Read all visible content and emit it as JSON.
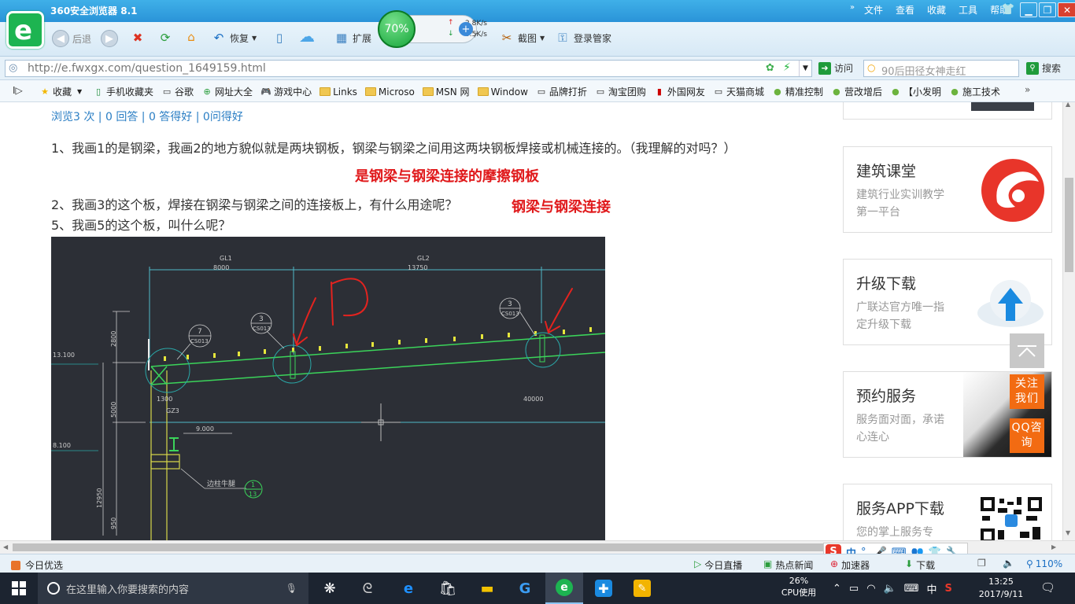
{
  "window": {
    "title": "360安全浏览器 8.1",
    "menu": [
      "文件",
      "查看",
      "收藏",
      "工具",
      "帮助"
    ]
  },
  "toolbar": {
    "back_label": "后退",
    "restore_label": "恢复",
    "extend_label": "扩展",
    "screenshot_label": "截图",
    "login_label": "登录管家"
  },
  "speed_widget": {
    "percent": "70%",
    "up": "2.8K/s",
    "down": "0.5K/s"
  },
  "address": {
    "url": "http://e.fwxgx.com/question_1649159.html",
    "visit_label": "访问",
    "search_placeholder": "90后田径女神走红",
    "search_label": "搜索"
  },
  "favorites": [
    {
      "label": "收藏",
      "icon": "star-icon"
    },
    {
      "label": "手机收藏夹",
      "icon": "phone-icon"
    },
    {
      "label": "谷歌",
      "icon": "page-icon"
    },
    {
      "label": "网址大全",
      "icon": "globe-icon"
    },
    {
      "label": "游戏中心",
      "icon": "gamepad-icon"
    },
    {
      "label": "Links",
      "icon": "folder-icon"
    },
    {
      "label": "Microso",
      "icon": "folder-icon"
    },
    {
      "label": "MSN 网",
      "icon": "folder-icon"
    },
    {
      "label": "Window",
      "icon": "folder-icon"
    },
    {
      "label": "品牌打折",
      "icon": "page-icon"
    },
    {
      "label": "淘宝团购",
      "icon": "page-icon"
    },
    {
      "label": "外国网友",
      "icon": "bookmark-icon"
    },
    {
      "label": "天猫商城",
      "icon": "page-icon"
    },
    {
      "label": "精准控制",
      "icon": "chat-icon"
    },
    {
      "label": "营改增后",
      "icon": "chat-icon"
    },
    {
      "label": "【小发明",
      "icon": "chat-icon"
    },
    {
      "label": "施工技术",
      "icon": "chat-icon"
    }
  ],
  "question": {
    "stats": "浏览3 次 | 0 回答 | 0 答得好 | 0问得好",
    "line1": "1、我画1的是钢梁，我画2的地方貌似就是两块钢板，钢梁与钢梁之间用这两块钢板焊接或机械连接的。（我理解的对吗？）",
    "answer1": "是钢梁与钢梁连接的摩擦钢板",
    "line2": "2、我画3的这个板，焊接在钢梁与钢梁之间的连接板上，有什么用途呢？",
    "answer2": "钢梁与钢梁连接",
    "line5": "5、我画5的这个板，叫什么呢？"
  },
  "cad": {
    "labels": {
      "gl1": "GL1",
      "gl1_len": "8000",
      "gl2": "GL2",
      "gl2_len": "13750",
      "h1": "2800",
      "h2": "5000",
      "h3": "12950",
      "h4": "950",
      "lv1": "13.100",
      "lv2": "8.100",
      "lv3": "9.000",
      "gz3": "GZ3",
      "d1300": "1300",
      "d40000": "40000",
      "tag7": "7",
      "tag3a": "3",
      "tag3b": "3",
      "cs013": "CS013",
      "bottom_note": "边柱牛腿",
      "tag1": "1",
      "tag13": "13"
    }
  },
  "sidebar": [
    {
      "title": "建筑课堂",
      "sub": "建筑行业实训教学第一平台",
      "icon": "swirl-logo-icon"
    },
    {
      "title": "升级下载",
      "sub": "广联达官方唯一指定升级下载",
      "icon": "cloud-download-icon"
    },
    {
      "title": "预约服务",
      "sub": "服务面对面，承诺心连心",
      "icon": "handshake-icon"
    },
    {
      "title": "服务APP下载",
      "sub": "您的掌上服务专",
      "icon": "qr-code-icon"
    }
  ],
  "float_buttons": {
    "follow": "关注我们",
    "qq": "QQ咨询"
  },
  "statusbar": {
    "left": "今日优选",
    "live": "今日直播",
    "hot": "热点新闻",
    "accel": "加速器",
    "download": "下载",
    "zoom": "110%"
  },
  "taskbar": {
    "search_placeholder": "在这里输入你要搜索的内容",
    "cpu_percent": "26%",
    "cpu_label": "CPU使用",
    "ime": "中",
    "time": "13:25",
    "date": "2017/9/11"
  }
}
